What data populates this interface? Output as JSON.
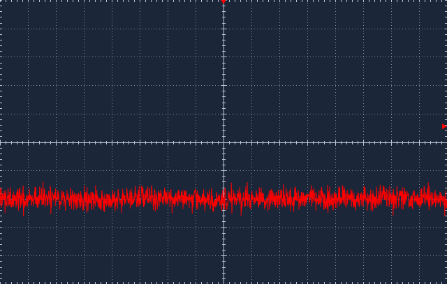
{
  "scope": {
    "grid": true,
    "divisions": {
      "horizontal": 16,
      "vertical": 10
    },
    "minor_ticks_per_division": 5,
    "colors": {
      "background": "#1c2639",
      "grid": "#7d8ea3",
      "axis": "#b9c6d6",
      "trace": "#ff0000",
      "markers": "#ff0000"
    },
    "markers": {
      "trigger_position": "top-center-arrow-icon",
      "trigger_level": "right-edge-arrow-icon"
    },
    "trace": {
      "name": "channel-1-trace",
      "center_divisions_below_mid": 2.0,
      "noise_amplitude_divisions": 0.45
    }
  }
}
